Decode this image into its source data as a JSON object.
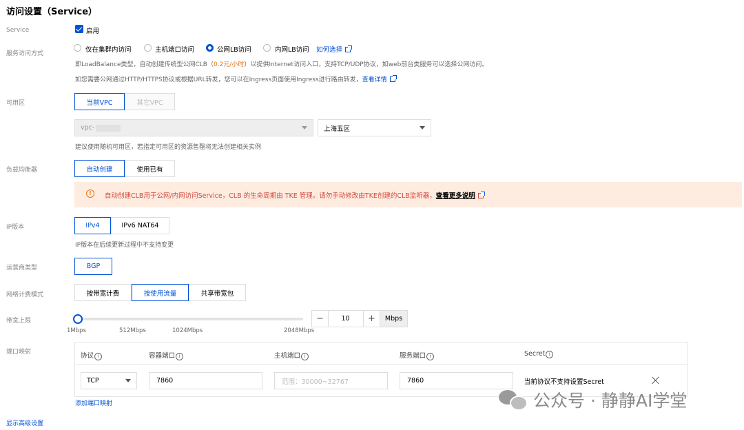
{
  "section_title": "访问设置（Service）",
  "service": {
    "label": "Service",
    "enable_label": "启用",
    "checked": true
  },
  "access_mode": {
    "label": "服务访问方式",
    "options": [
      "仅在集群内访问",
      "主机端口访问",
      "公网LB访问",
      "内网LB访问"
    ],
    "selected": "公网LB访问",
    "help_link": "如何选择",
    "desc1_prefix": "即LoadBalance类型，自动创建传统型公网CLB（",
    "desc1_price": "0.2元/小时",
    "desc1_suffix": "）以提供Internet访问入口，支持TCP/UDP协议，如web前台类服务可以选择公网访问。",
    "desc2": "如您需要公网通过HTTP/HTTPS协议或根据URL转发，您可以在Ingress页面使用Ingress进行路由转发，",
    "desc2_link": "查看详情"
  },
  "zone": {
    "label": "可用区",
    "tabs": [
      "当前VPC",
      "其它VPC"
    ],
    "vpc_value": "vpc-",
    "zone_value": "上海五区",
    "hint": "建议使用随机可用区，若指定可用区的资源售罄将无法创建相关实例"
  },
  "lb": {
    "label": "负载均衡器",
    "tabs": [
      "自动创建",
      "使用已有"
    ],
    "warning": "自动创建CLB用于公网/内网访问Service，CLB 的生命周期由 TKE 管理。请勿手动修改由TKE创建的CLB监听器，",
    "warning_link": "查看更多说明"
  },
  "ip_version": {
    "label": "IP版本",
    "tabs": [
      "IPv4",
      "IPv6 NAT64"
    ],
    "hint": "IP版本在后续更新过程中不支持变更"
  },
  "isp": {
    "label": "运营商类型",
    "tabs": [
      "BGP"
    ]
  },
  "billing": {
    "label": "网络计费模式",
    "tabs": [
      "按带宽计费",
      "按使用流量",
      "共享带宽包"
    ],
    "selected": "按使用流量"
  },
  "bandwidth": {
    "label": "带宽上限",
    "ticks": [
      "1Mbps",
      "512Mbps",
      "1024Mbps",
      "2048Mbps"
    ],
    "value": "10",
    "unit": "Mbps",
    "minus": "−",
    "plus": "+"
  },
  "ports": {
    "label": "端口映射",
    "headers": [
      "协议",
      "容器端口",
      "主机端口",
      "服务端口",
      "Secret"
    ],
    "row": {
      "protocol": "TCP",
      "container_port": "7860",
      "host_port_placeholder": "范围：30000~32767",
      "service_port": "7860",
      "secret": "当前协议不支持设置Secret"
    },
    "add_link": "添加端口映射"
  },
  "advanced_link": "显示高级设置",
  "watermark": "公众号 · 静静AI学堂",
  "colors": {
    "accent": "#0052d9",
    "warning_bg": "#fdecdf",
    "warning_text": "#d54941",
    "price": "#e37318"
  }
}
